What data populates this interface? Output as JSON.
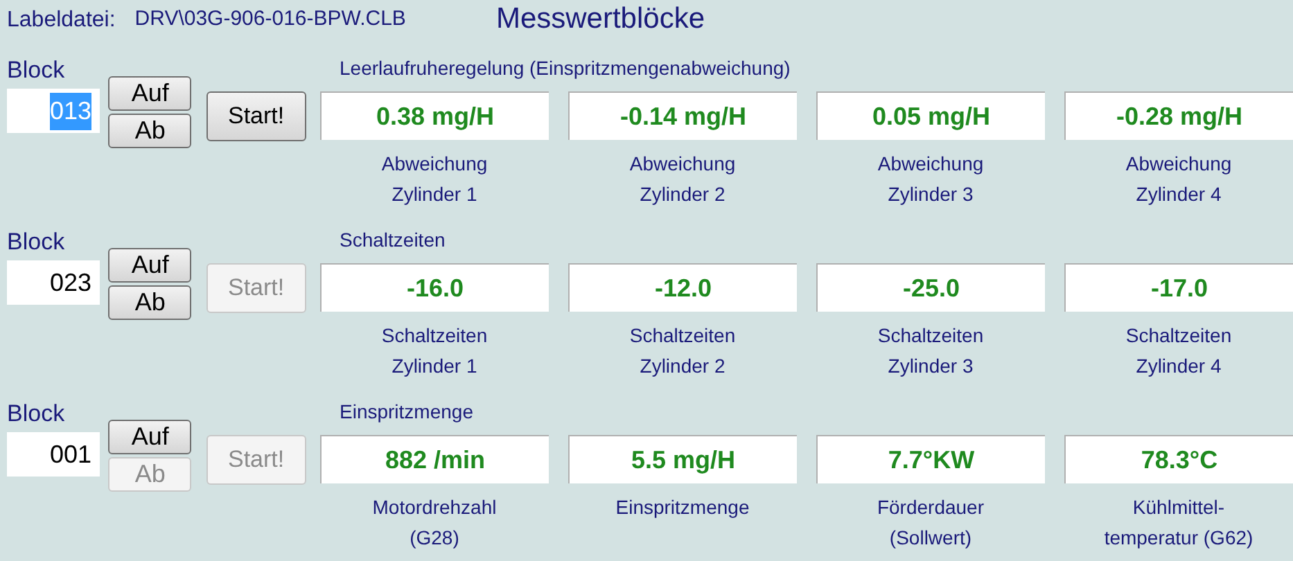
{
  "header": {
    "label": "Labeldatei:",
    "file": "DRV\\03G-906-016-BPW.CLB",
    "title": "Messwertblöcke"
  },
  "blocks": [
    {
      "label": "Block",
      "number": "013",
      "number_selected": true,
      "up": {
        "label": "Auf",
        "disabled": false
      },
      "down": {
        "label": "Ab",
        "disabled": false
      },
      "start": {
        "label": "Start!",
        "disabled": false
      },
      "group": "Leerlaufruheregelung (Einspritzmengenabweichung)",
      "values": [
        {
          "value": "0.38 mg/H",
          "caption": [
            "Abweichung",
            "Zylinder 1"
          ]
        },
        {
          "value": "-0.14 mg/H",
          "caption": [
            "Abweichung",
            "Zylinder 2"
          ]
        },
        {
          "value": "0.05 mg/H",
          "caption": [
            "Abweichung",
            "Zylinder 3"
          ]
        },
        {
          "value": "-0.28 mg/H",
          "caption": [
            "Abweichung",
            "Zylinder 4"
          ]
        }
      ]
    },
    {
      "label": "Block",
      "number": "023",
      "number_selected": false,
      "up": {
        "label": "Auf",
        "disabled": false
      },
      "down": {
        "label": "Ab",
        "disabled": false
      },
      "start": {
        "label": "Start!",
        "disabled": true
      },
      "group": "Schaltzeiten",
      "values": [
        {
          "value": "-16.0",
          "caption": [
            "Schaltzeiten",
            "Zylinder 1"
          ]
        },
        {
          "value": "-12.0",
          "caption": [
            "Schaltzeiten",
            "Zylinder 2"
          ]
        },
        {
          "value": "-25.0",
          "caption": [
            "Schaltzeiten",
            "Zylinder 3"
          ]
        },
        {
          "value": "-17.0",
          "caption": [
            "Schaltzeiten",
            "Zylinder 4"
          ]
        }
      ]
    },
    {
      "label": "Block",
      "number": "001",
      "number_selected": false,
      "up": {
        "label": "Auf",
        "disabled": false
      },
      "down": {
        "label": "Ab",
        "disabled": true
      },
      "start": {
        "label": "Start!",
        "disabled": true
      },
      "group": "Einspritzmenge",
      "values": [
        {
          "value": "882 /min",
          "caption": [
            "Motordrehzahl",
            "(G28)"
          ]
        },
        {
          "value": "5.5 mg/H",
          "caption": [
            "Einspritzmenge"
          ]
        },
        {
          "value": "7.7°KW",
          "caption": [
            "Förderdauer",
            "(Sollwert)"
          ]
        },
        {
          "value": "78.3°C",
          "caption": [
            "Kühlmittel-",
            "temperatur (G62)"
          ]
        }
      ]
    }
  ]
}
